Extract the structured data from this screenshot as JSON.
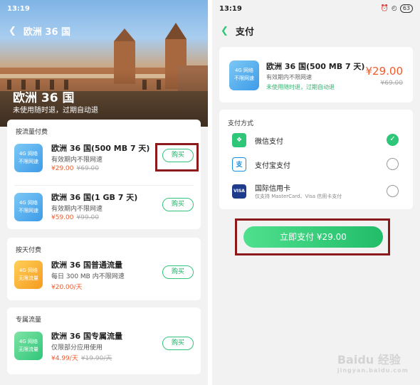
{
  "left": {
    "status": {
      "time": "13:19",
      "signal": "ᐧᐧ⁴ˡ"
    },
    "nav": {
      "title": "欧洲 36 国"
    },
    "hero": {
      "title": "欧洲 36 国",
      "subtitle": "未使用随时退，过期自动退"
    },
    "sections": [
      {
        "label": "按流量付费",
        "items": [
          {
            "badge": "4G 网络\n不限网速",
            "title": "欧洲 36 国(500 MB 7 天)",
            "desc": "有效期内不限网速",
            "price": "¥29.00",
            "old": "¥69.00",
            "buy": "购买"
          },
          {
            "badge": "4G 网络\n不限网速",
            "title": "欧洲 36 国(1 GB 7 天)",
            "desc": "有效期内不限网速",
            "price": "¥59.00",
            "old": "¥99.00",
            "buy": "购买"
          }
        ]
      },
      {
        "label": "按天付费",
        "items": [
          {
            "badge": "4G 网络\n无限流量",
            "title": "欧洲 36 国普通流量",
            "desc": "每日 300 MB 内不限网速",
            "price": "¥20.00/天",
            "old": "",
            "buy": "购买"
          }
        ]
      },
      {
        "label": "专属流量",
        "items": [
          {
            "badge": "4G 网络\n无限流量",
            "title": "欧洲 36 国专属流量",
            "desc": "仅限部分应用使用",
            "price": "¥4.99/天",
            "old": "¥19.90/天",
            "buy": "购买"
          }
        ]
      }
    ]
  },
  "right": {
    "status": {
      "time": "13:19",
      "signal": "ᐧᐧ⁴ˡ",
      "battery": "63"
    },
    "nav": {
      "title": "支付"
    },
    "order": {
      "badge": "4G 网络\n不限网速",
      "title": "欧洲 36 国(500 MB 7 天)",
      "desc": "有效期内不限网速",
      "note": "未使用随时退，过期自动退",
      "price": "¥29.00",
      "old": "¥69.00"
    },
    "payment": {
      "label": "支付方式",
      "methods": [
        {
          "label": "微信支付",
          "sub": "",
          "selected": true
        },
        {
          "label": "支付宝支付",
          "sub": "",
          "selected": false
        },
        {
          "label": "国际信用卡",
          "sub": "仅支持 MasterCard、Visa 信用卡支付",
          "selected": false
        }
      ],
      "pay_button": "立即支付 ¥29.00"
    }
  },
  "watermark": {
    "text": "Baidu 经验",
    "sub": "jingyan.baidu.com"
  },
  "colors": {
    "accent": "#2fc67a",
    "price": "#f25a2c",
    "highlight_box": "#8c1a1a"
  }
}
